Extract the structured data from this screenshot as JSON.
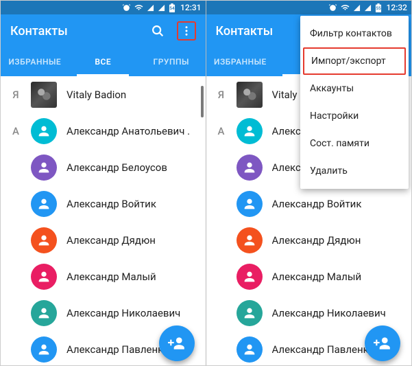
{
  "status": {
    "time_left": "12:31",
    "time_right": "12:32",
    "badge": "54",
    "badge_right": "55"
  },
  "header": {
    "title": "Контакты"
  },
  "tabs": {
    "favorites": "ИЗБРАННЫЕ",
    "all": "ВСЕ",
    "groups": "ГРУППЫ"
  },
  "sections": [
    {
      "letter": "Я",
      "contacts": [
        {
          "name": "Vitaly Badion",
          "avatar": "photo"
        }
      ]
    },
    {
      "letter": "А",
      "contacts": [
        {
          "name": "Александр Анатольевич .",
          "avatar": "#00bcd4"
        },
        {
          "name": "Александр Белоусов",
          "avatar": "#7e57c2"
        },
        {
          "name": "Александр Войтик",
          "avatar": "#2196f3"
        },
        {
          "name": "Александр Дядюн",
          "avatar": "#f4511e"
        },
        {
          "name": "Александр Малый",
          "avatar": "#e91e63"
        },
        {
          "name": "Александр Николаевич",
          "avatar": "#26a69a"
        },
        {
          "name": "Александр Павленко",
          "avatar": "#2196f3"
        }
      ]
    }
  ],
  "menu": {
    "filter": "Фильтр контактов",
    "import_export": "Импорт/экспорт",
    "accounts": "Аккаунты",
    "settings": "Настройки",
    "storage": "Сост. памяти",
    "delete": "Удалить"
  }
}
